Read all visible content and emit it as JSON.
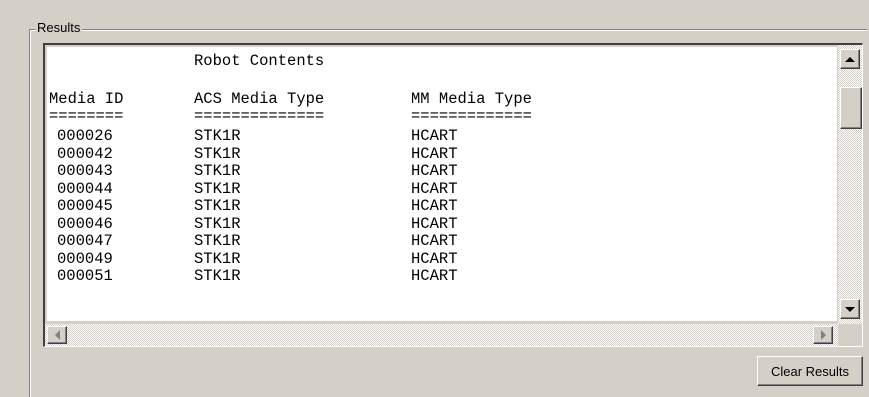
{
  "group": {
    "label": "Results"
  },
  "results": {
    "title": "Robot Contents",
    "headers": [
      "Media ID",
      "ACS Media Type",
      "MM Media Type"
    ],
    "separators": [
      "========",
      "==============",
      "============="
    ],
    "rows": [
      [
        "000026",
        "STK1R",
        "HCART"
      ],
      [
        "000042",
        "STK1R",
        "HCART"
      ],
      [
        "000043",
        "STK1R",
        "HCART"
      ],
      [
        "000044",
        "STK1R",
        "HCART"
      ],
      [
        "000045",
        "STK1R",
        "HCART"
      ],
      [
        "000046",
        "STK1R",
        "HCART"
      ],
      [
        "000047",
        "STK1R",
        "HCART"
      ],
      [
        "000049",
        "STK1R",
        "HCART"
      ],
      [
        "000051",
        "STK1R",
        "HCART"
      ]
    ]
  },
  "buttons": {
    "clear": "Clear Results"
  }
}
